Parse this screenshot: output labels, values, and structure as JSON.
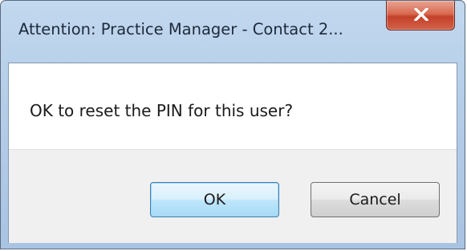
{
  "window": {
    "title": "Attention: Practice Manager - Contact 2..."
  },
  "dialog": {
    "message": "OK to reset the PIN for this user?",
    "buttons": {
      "ok_label": "OK",
      "cancel_label": "Cancel"
    },
    "default_button": "OK"
  },
  "icons": {
    "close": "close-icon"
  },
  "colors": {
    "titlebar": "#b5cde8",
    "close_button": "#c3412a",
    "default_button_border": "#3c7fb1",
    "button_area": "#f0f0f0"
  }
}
